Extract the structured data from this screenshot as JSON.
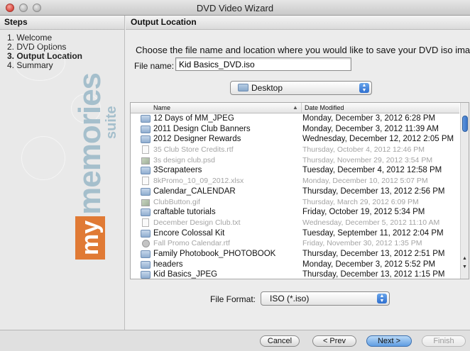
{
  "window": {
    "title": "DVD Video Wizard"
  },
  "sidebar": {
    "header": "Steps",
    "items": [
      {
        "label": "1. Welcome",
        "active": false
      },
      {
        "label": "2. DVD Options",
        "active": false
      },
      {
        "label": "3. Output Location",
        "active": true
      },
      {
        "label": "4. Summary",
        "active": false
      }
    ],
    "logo": {
      "my": "my",
      "memories": "memories",
      "suite": "suite"
    }
  },
  "main": {
    "header": "Output Location",
    "instruction": "Choose the file name and location where you would like to save your DVD iso image.",
    "filename": {
      "label": "File name:",
      "value": "Kid Basics_DVD.iso"
    },
    "location": {
      "value": "Desktop"
    },
    "browser": {
      "columns": {
        "name": "Name",
        "date": "Date Modified"
      },
      "rows": [
        {
          "name": "12 Days of MM_JPEG",
          "date": "Monday, December 3, 2012 6:28 PM",
          "type": "folder",
          "enabled": true
        },
        {
          "name": "2011 Design Club Banners",
          "date": "Monday, December 3, 2012 11:39 AM",
          "type": "folder",
          "enabled": true
        },
        {
          "name": "2012 Designer Rewards",
          "date": "Wednesday, December 12, 2012 2:05 PM",
          "type": "folder",
          "enabled": true
        },
        {
          "name": "35 Club Store Credits.rtf",
          "date": "Thursday, October 4, 2012 12:46 PM",
          "type": "doc",
          "enabled": false
        },
        {
          "name": "3s design club.psd",
          "date": "Thursday, November 29, 2012 3:54 PM",
          "type": "image",
          "enabled": false
        },
        {
          "name": "3Scrapateers",
          "date": "Tuesday, December 4, 2012 12:58 PM",
          "type": "folder",
          "enabled": true
        },
        {
          "name": "8kPromo_10_09_2012.xlsx",
          "date": "Monday, December 10, 2012 5:07 PM",
          "type": "doc",
          "enabled": false
        },
        {
          "name": "Calendar_CALENDAR",
          "date": "Thursday, December 13, 2012 2:56 PM",
          "type": "folder",
          "enabled": true
        },
        {
          "name": "ClubButton.gif",
          "date": "Thursday, March 29, 2012 6:09 PM",
          "type": "image",
          "enabled": false
        },
        {
          "name": "craftable tutorials",
          "date": "Friday, October 19, 2012 5:34 PM",
          "type": "folder",
          "enabled": true
        },
        {
          "name": "December Design Club.txt",
          "date": "Wednesday, December 5, 2012 11:10 AM",
          "type": "doc",
          "enabled": false
        },
        {
          "name": "Encore Colossal Kit",
          "date": "Tuesday, September 11, 2012 2:04 PM",
          "type": "folder",
          "enabled": true
        },
        {
          "name": "Fall Promo Calendar.rtf",
          "date": "Friday, November 30, 2012 1:35 PM",
          "type": "gear",
          "enabled": false
        },
        {
          "name": "Family Photobook_PHOTOBOOK",
          "date": "Thursday, December 13, 2012 2:51 PM",
          "type": "folder",
          "enabled": true
        },
        {
          "name": "headers",
          "date": "Monday, December 3, 2012 5:52 PM",
          "type": "folder",
          "enabled": true
        },
        {
          "name": "Kid Basics_JPEG",
          "date": "Thursday, December 13, 2012 1:15 PM",
          "type": "folder",
          "enabled": true
        }
      ]
    },
    "format": {
      "label": "File Format:",
      "value": "ISO (*.iso)"
    }
  },
  "buttons": {
    "cancel": "Cancel",
    "prev": "< Prev",
    "next": "Next >",
    "finish": "Finish"
  }
}
